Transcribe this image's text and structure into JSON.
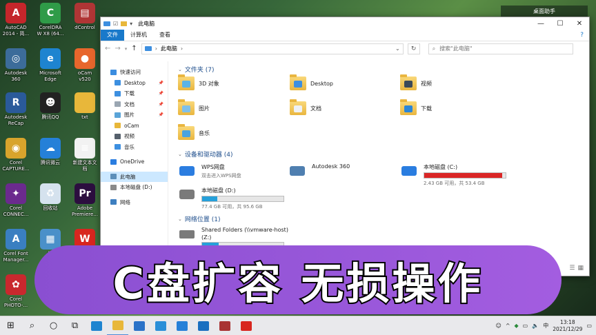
{
  "desktop": {
    "icons": [
      {
        "label": "AutoCAD",
        "label2": "2014 - 简...",
        "icon": "autocad-icon",
        "color": "#c4262b",
        "glyph": "A"
      },
      {
        "label": "CorelDRA",
        "label2": "W X8 (64...",
        "icon": "coreldraw-icon",
        "color": "#2f9b48",
        "glyph": "C"
      },
      {
        "label": "dControl",
        "label2": "",
        "icon": "dcontrol-archive-icon",
        "color": "#b03535",
        "glyph": "▤"
      },
      {
        "label": "Autodesk",
        "label2": "360",
        "icon": "autodesk-360-icon",
        "color": "#3c6c9a",
        "glyph": "◎"
      },
      {
        "label": "Microsoft",
        "label2": "Edge",
        "icon": "edge-icon",
        "color": "#1e84d0",
        "glyph": "e"
      },
      {
        "label": "oCam",
        "label2": "v520",
        "icon": "ocam-icon",
        "color": "#e7662c",
        "glyph": "●"
      },
      {
        "label": "Autodesk",
        "label2": "ReCap",
        "icon": "autodesk-recap-icon",
        "color": "#2a5a9a",
        "glyph": "R"
      },
      {
        "label": "腾讯QQ",
        "label2": "",
        "icon": "qq-icon",
        "color": "#222222",
        "glyph": "☻"
      },
      {
        "label": "txt",
        "label2": "",
        "icon": "folder-icon",
        "color": "#e8b73a",
        "glyph": ""
      },
      {
        "label": "Corel",
        "label2": "CAPTURE...",
        "icon": "corel-capture-icon",
        "color": "#d8a42c",
        "glyph": "◉"
      },
      {
        "label": "腾讯微云",
        "label2": "",
        "icon": "weiyun-icon",
        "color": "#2580d8",
        "glyph": "☁"
      },
      {
        "label": "新建文本文",
        "label2": "档",
        "icon": "text-document-icon",
        "color": "#f2f2f2",
        "glyph": "≡"
      },
      {
        "label": "Corel",
        "label2": "CONNEC...",
        "icon": "corel-connect-icon",
        "color": "#6b2a8e",
        "glyph": "✦"
      },
      {
        "label": "回收站",
        "label2": "",
        "icon": "recycle-bin-icon",
        "color": "#d5e2ee",
        "glyph": "♻"
      },
      {
        "label": "Adobe",
        "label2": "Premiere...",
        "icon": "premiere-icon",
        "color": "#2c0e3f",
        "glyph": "Pr"
      },
      {
        "label": "Corel Font",
        "label2": "Manager...",
        "icon": "corel-font-manager-icon",
        "color": "#3a7fc1",
        "glyph": "A"
      },
      {
        "label": "控",
        "label2": "",
        "icon": "control-panel-icon",
        "color": "#4a90c9",
        "glyph": "▦"
      },
      {
        "label": "",
        "label2": "",
        "icon": "wps-office-icon",
        "color": "#d8261f",
        "glyph": "W"
      },
      {
        "label": "Corel",
        "label2": "PHOTO-...",
        "icon": "corel-photo-paint-icon",
        "color": "#c9282e",
        "glyph": "✿"
      }
    ],
    "widget_title": "桌面助手"
  },
  "window": {
    "title": "此电脑",
    "tabs": [
      "文件",
      "计算机",
      "查看"
    ],
    "help": "?",
    "address": "此电脑",
    "search_placeholder": "搜索\"此电脑\"",
    "nav": [
      {
        "label": "快速访问",
        "icon": "star-icon",
        "color": "#3a8de0",
        "level": 0,
        "pin": false
      },
      {
        "label": "Desktop",
        "icon": "desktop-folder-icon",
        "color": "#3d8fe0",
        "level": 1,
        "pin": true
      },
      {
        "label": "下载",
        "icon": "download-folder-icon",
        "color": "#3d8fe0",
        "level": 1,
        "pin": true
      },
      {
        "label": "文档",
        "icon": "documents-folder-icon",
        "color": "#9aa6b2",
        "level": 1,
        "pin": true
      },
      {
        "label": "图片",
        "icon": "pictures-folder-icon",
        "color": "#5aa4d8",
        "level": 1,
        "pin": true
      },
      {
        "label": "oCam",
        "icon": "folder-icon",
        "color": "#e8b73a",
        "level": 1,
        "pin": false
      },
      {
        "label": "视频",
        "icon": "videos-folder-icon",
        "color": "#55606c",
        "level": 1,
        "pin": false
      },
      {
        "label": "音乐",
        "icon": "music-folder-icon",
        "color": "#3d8fe0",
        "level": 1,
        "pin": false
      },
      {
        "label": "OneDrive",
        "icon": "onedrive-icon",
        "color": "#2a7de0",
        "level": 0,
        "pin": false
      },
      {
        "label": "此电脑",
        "icon": "this-pc-icon",
        "color": "#5d8fb9",
        "level": 0,
        "pin": false,
        "selected": true
      },
      {
        "label": "本地磁盘 (D:)",
        "icon": "drive-icon",
        "color": "#8a8a8a",
        "level": 0,
        "pin": false
      },
      {
        "label": "网络",
        "icon": "network-icon",
        "color": "#3d7fc0",
        "level": 0,
        "pin": false
      }
    ],
    "sections": {
      "folders": {
        "title": "文件夹 (7)"
      },
      "devices": {
        "title": "设备和驱动器 (4)"
      },
      "network": {
        "title": "网络位置 (1)"
      }
    },
    "folders": [
      {
        "label": "3D 对象",
        "icon": "3d-objects-folder-icon",
        "badge": "#5ab3e6"
      },
      {
        "label": "Desktop",
        "icon": "desktop-folder-icon",
        "badge": "#3d8fe0"
      },
      {
        "label": "视频",
        "icon": "videos-folder-icon",
        "badge": "#3b4a5a"
      },
      {
        "label": "图片",
        "icon": "pictures-folder-icon",
        "badge": "#7fc0ea"
      },
      {
        "label": "文档",
        "icon": "documents-folder-icon",
        "badge": "#eef1f4"
      },
      {
        "label": "下载",
        "icon": "downloads-folder-icon",
        "badge": "#2b86d8"
      },
      {
        "label": "音乐",
        "icon": "music-folder-icon",
        "badge": "#4aa3e0"
      }
    ],
    "drives": [
      {
        "name": "WPS网盘",
        "sub": "双击进入WPS网盘",
        "icon": "wps-cloud-icon",
        "color": "#2b7de0",
        "has_bar": false
      },
      {
        "name": "Autodesk 360",
        "sub": "",
        "icon": "autodesk-360-icon",
        "color": "#4f7fb0",
        "has_bar": false
      },
      {
        "name": "本地磁盘 (C:)",
        "sub": "2.43 GB 可用，共 53.4 GB",
        "icon": "windows-drive-icon",
        "color": "#2a7de0",
        "has_bar": true,
        "used_fraction": 0.955,
        "bar_color": "#da2626"
      },
      {
        "name": "本地磁盘 (D:)",
        "sub": "77.4 GB 可用，共 95.6 GB",
        "icon": "hard-drive-icon",
        "color": "#7a7a7a",
        "has_bar": true,
        "used_fraction": 0.19,
        "bar_color": "#26a0da"
      }
    ],
    "network_items": [
      {
        "name": "Shared Folders (\\\\vmware-host)",
        "name2": "(Z:)",
        "icon": "network-drive-icon",
        "color": "#7a7a7a",
        "has_bar": true,
        "used_fraction": 0.2,
        "bar_color": "#26a0da"
      }
    ]
  },
  "banner": {
    "text": "C盘扩容 无损操作"
  },
  "taskbar": {
    "items": [
      {
        "icon": "windows-start-icon",
        "glyph": "⊞"
      },
      {
        "icon": "search-icon",
        "glyph": "⌕"
      },
      {
        "icon": "cortana-icon",
        "glyph": "○"
      },
      {
        "icon": "task-view-icon",
        "glyph": "⧉"
      },
      {
        "icon": "edge-icon",
        "color": "#1e84d0"
      },
      {
        "icon": "file-explorer-icon",
        "color": "#e8b73a",
        "active": true
      },
      {
        "icon": "mail-icon",
        "color": "#2a72c8"
      },
      {
        "icon": "ie-icon",
        "color": "#2a8fd8"
      },
      {
        "icon": "weiyun-icon",
        "color": "#2580d8"
      },
      {
        "icon": "store-icon",
        "color": "#1a6fc0"
      },
      {
        "icon": "winrar-icon",
        "color": "#a83232"
      },
      {
        "icon": "wps-icon",
        "color": "#d8261f"
      }
    ],
    "time": "13:18",
    "date": "2021/12/29"
  }
}
